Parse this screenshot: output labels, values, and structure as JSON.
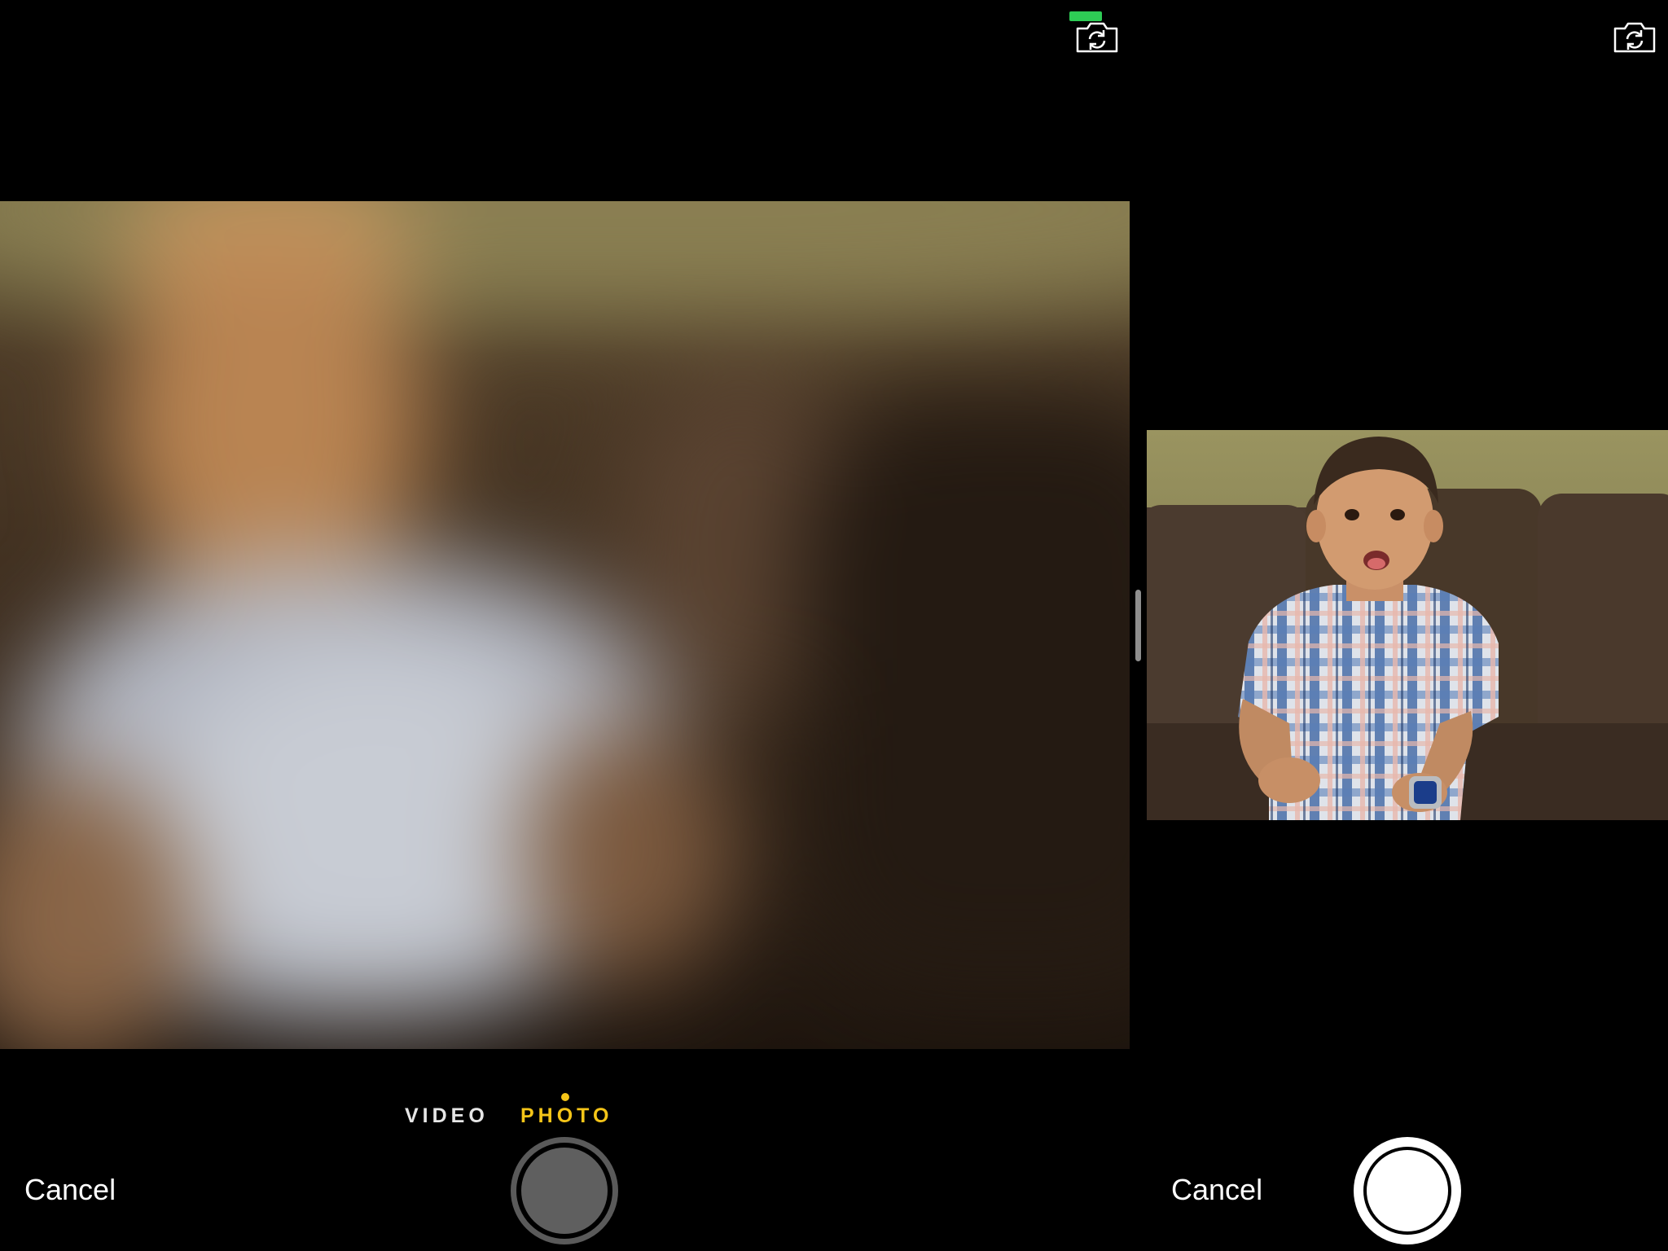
{
  "left_app": {
    "modes": [
      {
        "label": "VIDEO",
        "selected": false
      },
      {
        "label": "PHOTO",
        "selected": true
      }
    ],
    "cancel_label": "Cancel",
    "flip_camera_icon": "camera-flip-icon",
    "active_indicator_color": "#2ecc55",
    "selected_mode_color": "#f5c518"
  },
  "right_app": {
    "cancel_label": "Cancel",
    "flip_camera_icon": "camera-flip-icon"
  }
}
